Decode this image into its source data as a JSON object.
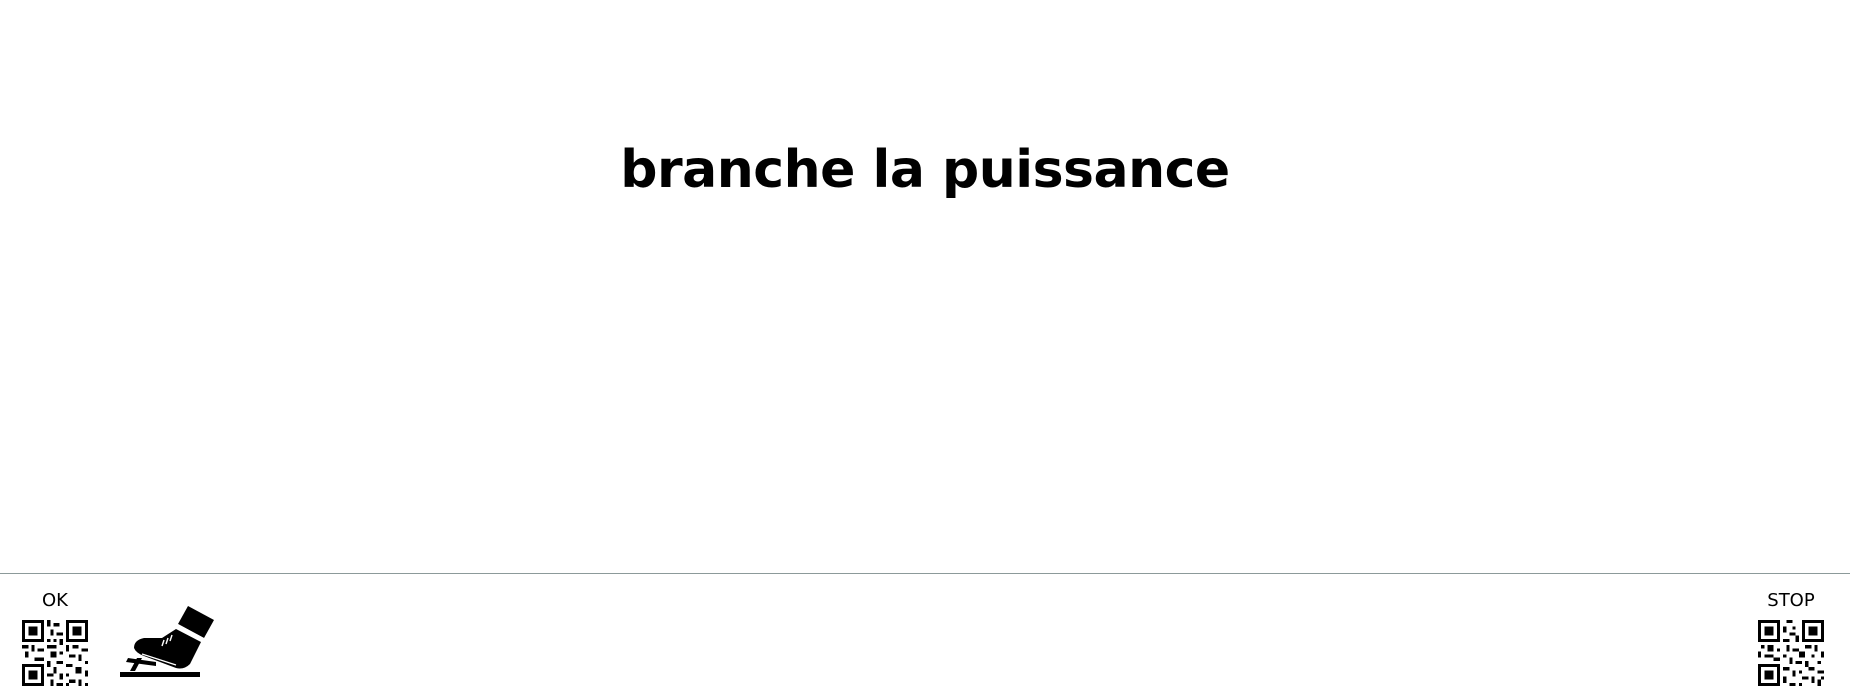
{
  "prompt": {
    "title": "branche la puissance"
  },
  "actions": {
    "ok": {
      "label": "OK",
      "icon": "qr-code-icon"
    },
    "stop": {
      "label": "STOP",
      "icon": "qr-code-icon"
    }
  },
  "indicator": {
    "icon": "foot-pedal-icon"
  },
  "colors": {
    "text": "#000000",
    "divider": "#8c9a9a",
    "background": "#ffffff"
  }
}
